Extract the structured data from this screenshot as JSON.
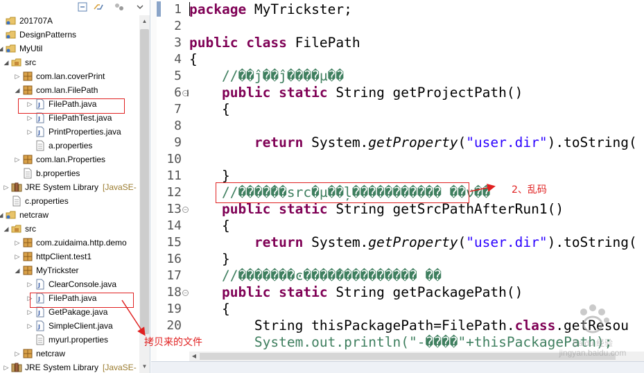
{
  "colors": {
    "keyword": "#7f0055",
    "string": "#2a00ff",
    "comment": "#3f7f5f",
    "annotation": "#e02020",
    "decoration": "#9a7b2e"
  },
  "explorer": {
    "toolbar_icons": [
      "collapse-all-icon",
      "link-with-editor-icon",
      "focus-icon",
      "view-menu-icon"
    ],
    "tree": [
      {
        "label": "201707A",
        "kind": "project",
        "decor": ""
      },
      {
        "label": "DesignPatterns",
        "kind": "project",
        "decor": ""
      },
      {
        "label": "MyUtil",
        "kind": "project",
        "decor": ""
      },
      {
        "label": "src",
        "kind": "src-folder",
        "decor": ""
      },
      {
        "label": "com.lan.coverPrint",
        "kind": "package",
        "decor": ""
      },
      {
        "label": "com.lan.FilePath",
        "kind": "package",
        "decor": ""
      },
      {
        "label": "FilePath.java",
        "kind": "java-file",
        "decor": ""
      },
      {
        "label": "FilePathTest.java",
        "kind": "java-file",
        "decor": ""
      },
      {
        "label": "PrintProperties.java",
        "kind": "java-file",
        "decor": ""
      },
      {
        "label": "a.properties",
        "kind": "properties-file",
        "decor": ""
      },
      {
        "label": "com.lan.Properties",
        "kind": "package",
        "decor": ""
      },
      {
        "label": "b.properties",
        "kind": "properties-file",
        "decor": ""
      },
      {
        "label": "JRE System Library",
        "kind": "library",
        "decor": "[JavaSE-"
      },
      {
        "label": "c.properties",
        "kind": "properties-file",
        "decor": ""
      },
      {
        "label": "netcraw",
        "kind": "project",
        "decor": ""
      },
      {
        "label": "src",
        "kind": "src-folder",
        "decor": ""
      },
      {
        "label": "com.zuidaima.http.demo",
        "kind": "package",
        "decor": ""
      },
      {
        "label": "httpClient.test1",
        "kind": "package",
        "decor": ""
      },
      {
        "label": "MyTrickster",
        "kind": "package",
        "decor": ""
      },
      {
        "label": "ClearConsole.java",
        "kind": "java-file",
        "decor": ""
      },
      {
        "label": "FilePath.java",
        "kind": "java-file",
        "decor": ""
      },
      {
        "label": "GetPakage.java",
        "kind": "java-file",
        "decor": ""
      },
      {
        "label": "SimpleClient.java",
        "kind": "java-file",
        "decor": ""
      },
      {
        "label": "myurl.properties",
        "kind": "properties-file",
        "decor": ""
      },
      {
        "label": "netcraw",
        "kind": "package",
        "decor": ""
      },
      {
        "label": "JRE System Library",
        "kind": "library",
        "decor": "[JavaSE-"
      }
    ]
  },
  "editor": {
    "line_numbers": [
      "1",
      "2",
      "3",
      "4",
      "5",
      "6",
      "7",
      "8",
      "9",
      "10",
      "11",
      "12",
      "13",
      "14",
      "15",
      "16",
      "17",
      "18",
      "19",
      "20"
    ],
    "lines": [
      [
        {
          "t": "package",
          "c": "kw"
        },
        {
          "t": " MyTrickster;",
          "c": ""
        }
      ],
      [],
      [
        {
          "t": "public",
          "c": "kw"
        },
        {
          "t": " ",
          "c": ""
        },
        {
          "t": "class",
          "c": "kw"
        },
        {
          "t": " FilePath",
          "c": ""
        }
      ],
      [
        {
          "t": "{",
          "c": ""
        }
      ],
      [
        {
          "t": "    //��ĵ��ĵ����µ��",
          "c": "cmt"
        }
      ],
      [
        {
          "t": "    ",
          "c": ""
        },
        {
          "t": "public",
          "c": "kw"
        },
        {
          "t": " ",
          "c": ""
        },
        {
          "t": "static",
          "c": "kw"
        },
        {
          "t": " String getProjectPath()",
          "c": ""
        }
      ],
      [
        {
          "t": "    {",
          "c": ""
        }
      ],
      [],
      [
        {
          "t": "        ",
          "c": ""
        },
        {
          "t": "return",
          "c": "kw"
        },
        {
          "t": " System.",
          "c": ""
        },
        {
          "t": "getProperty",
          "c": "it"
        },
        {
          "t": "(",
          "c": ""
        },
        {
          "t": "\"user.dir\"",
          "c": "str"
        },
        {
          "t": ").toString(",
          "c": ""
        }
      ],
      [],
      [
        {
          "t": "    }",
          "c": ""
        }
      ],
      [
        {
          "t": "    //����̃��src�µ��ļ����������� ��ν��",
          "c": "cmt"
        }
      ],
      [
        {
          "t": "    ",
          "c": ""
        },
        {
          "t": "public",
          "c": "kw"
        },
        {
          "t": " ",
          "c": ""
        },
        {
          "t": "static",
          "c": "kw"
        },
        {
          "t": " String getSrcPathAfterRun1()",
          "c": ""
        }
      ],
      [
        {
          "t": "    {",
          "c": ""
        }
      ],
      [
        {
          "t": "        ",
          "c": ""
        },
        {
          "t": "return",
          "c": "kw"
        },
        {
          "t": " System.",
          "c": ""
        },
        {
          "t": "getProperty",
          "c": "it"
        },
        {
          "t": "(",
          "c": ""
        },
        {
          "t": "\"user.dir\"",
          "c": "str"
        },
        {
          "t": ").toString(",
          "c": ""
        }
      ],
      [
        {
          "t": "    }",
          "c": ""
        }
      ],
      [
        {
          "t": "    //�������ͼ����̃���������� ��",
          "c": "cmt"
        }
      ],
      [
        {
          "t": "    ",
          "c": ""
        },
        {
          "t": "public",
          "c": "kw"
        },
        {
          "t": " ",
          "c": ""
        },
        {
          "t": "static",
          "c": "kw"
        },
        {
          "t": " String getPackagePath()",
          "c": ""
        }
      ],
      [
        {
          "t": "    {",
          "c": ""
        }
      ],
      [
        {
          "t": "        String thisPackagePath=FilePath.",
          "c": ""
        },
        {
          "t": "class",
          "c": "kw"
        },
        {
          "t": ".getResou",
          "c": ""
        }
      ],
      [
        {
          "t": "        System.",
          "c": "cmt"
        },
        {
          "t": "out",
          "c": "cmt"
        },
        {
          "t": ".println(\"-����\"+thisPackagePath);",
          "c": "cmt"
        }
      ]
    ],
    "fold_lines": [
      "6",
      "13",
      "18"
    ]
  },
  "annotations": {
    "garbled_label": "2、乱码",
    "copied_file_label": "拷贝来的文件"
  },
  "watermark": "Baidu 经验\njingyan.baidu.com"
}
